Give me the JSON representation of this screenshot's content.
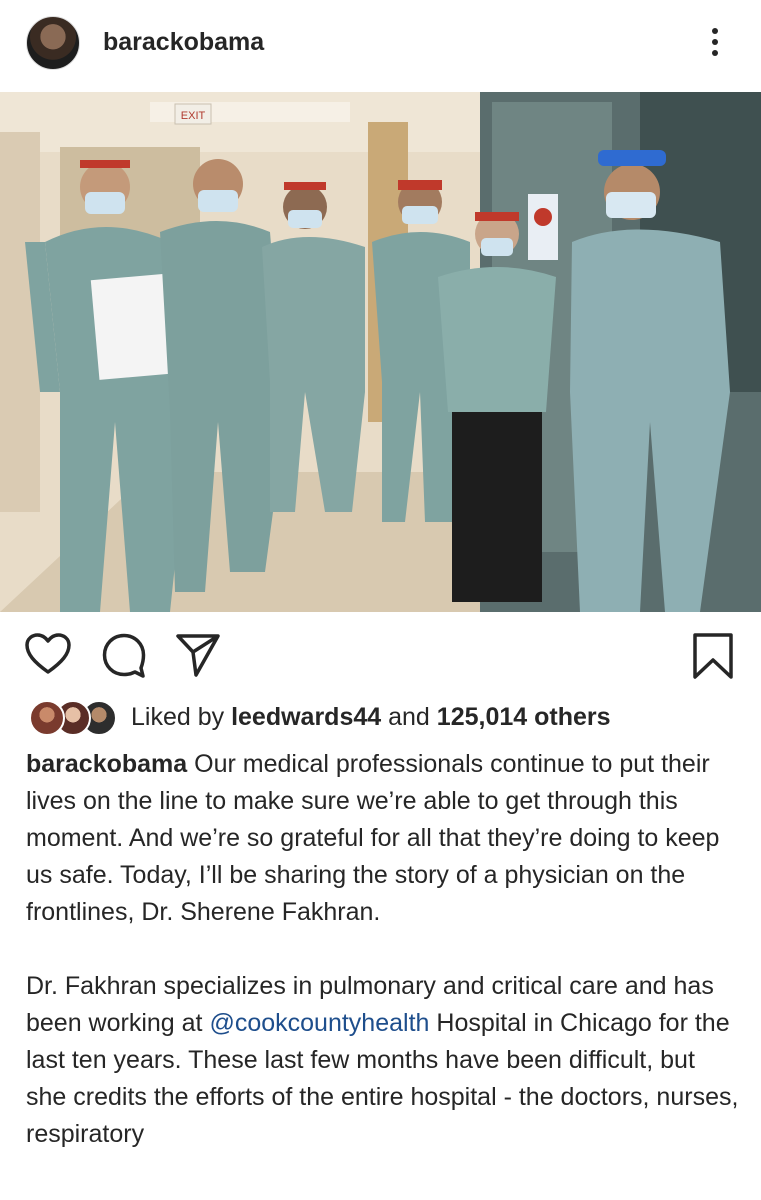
{
  "post": {
    "username": "barackobama",
    "avatar_icon": "profile-photo"
  },
  "header": {
    "more_icon": "more-vertical-icon"
  },
  "actions": {
    "like_icon": "heart-icon",
    "comment_icon": "comment-icon",
    "share_icon": "send-icon",
    "save_icon": "bookmark-icon"
  },
  "likes": {
    "prefix": "Liked by",
    "user": "leedwards44",
    "middle": "and",
    "others": "125,014 others"
  },
  "caption": {
    "username": "barackobama",
    "p1": "Our medical professionals continue to put their lives on the line to make sure we’re able to get through this moment. And we’re so grateful for all that they’re doing to keep us safe. Today, I’ll be sharing the story of a physician on the frontlines, Dr. Sherene Fakhran.",
    "p2_before": "Dr. Fakhran specializes in pulmonary and critical care and has been working at",
    "mention": "@cookcountyhealth",
    "p2_after": "Hospital in Chicago for the last ten years. These last few months have been difficult, but she credits the efforts of the entire hospital - the doctors, nurses, respiratory"
  },
  "photo": {
    "exit_sign": "EXIT"
  },
  "colors": {
    "scrubs": "#7fa3a0",
    "mention": "#1e4e8c",
    "text": "#262626"
  }
}
